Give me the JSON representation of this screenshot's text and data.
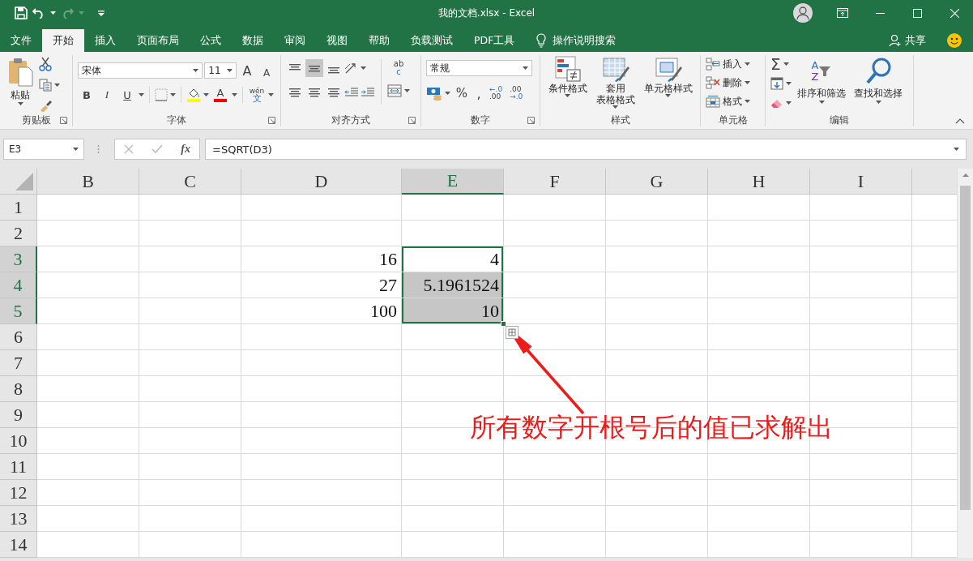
{
  "title_bar": {
    "title": "我的文档.xlsx  -  Excel",
    "redo_disabled": true
  },
  "tabs": [
    {
      "label": "文件",
      "selected": false
    },
    {
      "label": "开始",
      "selected": true
    },
    {
      "label": "插入",
      "selected": false
    },
    {
      "label": "页面布局",
      "selected": false
    },
    {
      "label": "公式",
      "selected": false
    },
    {
      "label": "数据",
      "selected": false
    },
    {
      "label": "审阅",
      "selected": false
    },
    {
      "label": "视图",
      "selected": false
    },
    {
      "label": "帮助",
      "selected": false
    },
    {
      "label": "负载测试",
      "selected": false
    },
    {
      "label": "PDF工具",
      "selected": false
    }
  ],
  "tell_me": "操作说明搜索",
  "share": "共享",
  "ribbon": {
    "clipboard": {
      "paste": "粘贴",
      "label": "剪贴板"
    },
    "font": {
      "name": "宋体",
      "size": "11",
      "grow": "A",
      "shrink": "A",
      "bold": "B",
      "italic": "I",
      "underline": "U",
      "color_letter": "A",
      "phonetic": [
        "wén",
        "文"
      ],
      "label": "字体"
    },
    "alignment": {
      "vertical_align": [
        {
          "selected": false
        },
        {
          "selected": true
        },
        {
          "selected": false
        }
      ],
      "horizontal_align": [
        {
          "selected": false
        },
        {
          "selected": false
        },
        {
          "selected": false
        }
      ],
      "wrap_text": [
        "ab",
        "c"
      ],
      "label": "对齐方式"
    },
    "number": {
      "format": "常规",
      "percent": "%",
      "comma": ",",
      "increase_decimal": [
        "←.0",
        ".00"
      ],
      "decrease_decimal": [
        ".00",
        "→.0"
      ],
      "label": "数字"
    },
    "styles": {
      "buttons": [
        {
          "kind": "conditional",
          "lines": [
            "条件格式"
          ]
        },
        {
          "kind": "table",
          "lines": [
            "套用",
            "表格格式"
          ]
        },
        {
          "kind": "cell_style",
          "lines": [
            "单元格样式"
          ]
        }
      ],
      "label": "样式"
    },
    "cells": {
      "buttons": [
        {
          "kind": "insert",
          "label": "插入"
        },
        {
          "kind": "delete",
          "label": "删除"
        },
        {
          "kind": "format",
          "label": "格式"
        }
      ],
      "label": "单元格"
    },
    "editing": {
      "sum": "Σ",
      "sort": {
        "letters": [
          "A",
          "Z"
        ],
        "label": "排序和筛选"
      },
      "find": "查找和选择",
      "label": "编辑"
    }
  },
  "formula_bar": {
    "name_box": "E3",
    "fx": "fx",
    "formula": "=SQRT(D3)"
  },
  "sheet": {
    "columns": [
      {
        "label": "B",
        "selected": false
      },
      {
        "label": "C",
        "selected": false
      },
      {
        "label": "D",
        "selected": false
      },
      {
        "label": "E",
        "selected": true
      },
      {
        "label": "F",
        "selected": false
      },
      {
        "label": "G",
        "selected": false
      },
      {
        "label": "H",
        "selected": false
      },
      {
        "label": "I",
        "selected": false
      }
    ],
    "rows": [
      {
        "header": "1",
        "selected": false
      },
      {
        "header": "2",
        "selected": false
      },
      {
        "header": "3",
        "selected": true,
        "cells": [
          null,
          null,
          {
            "value": "16",
            "selected": false,
            "active": false
          },
          {
            "value": "4",
            "selected": true,
            "active": true
          }
        ]
      },
      {
        "header": "4",
        "selected": true,
        "cells": [
          null,
          null,
          {
            "value": "27",
            "selected": false,
            "active": false
          },
          {
            "value": "5.1961524",
            "selected": true,
            "active": false
          }
        ]
      },
      {
        "header": "5",
        "selected": true,
        "cells": [
          null,
          null,
          {
            "value": "100",
            "selected": false,
            "active": false
          },
          {
            "value": "10",
            "selected": true,
            "active": false
          }
        ]
      },
      {
        "header": "6",
        "selected": false
      },
      {
        "header": "7",
        "selected": false
      },
      {
        "header": "8",
        "selected": false
      },
      {
        "header": "9",
        "selected": false
      },
      {
        "header": "10",
        "selected": false
      },
      {
        "header": "11",
        "selected": false
      },
      {
        "header": "12",
        "selected": false
      },
      {
        "header": "13",
        "selected": false
      },
      {
        "header": "14",
        "selected": false
      }
    ]
  },
  "annotation": "所有数字开根号后的值已求解出"
}
